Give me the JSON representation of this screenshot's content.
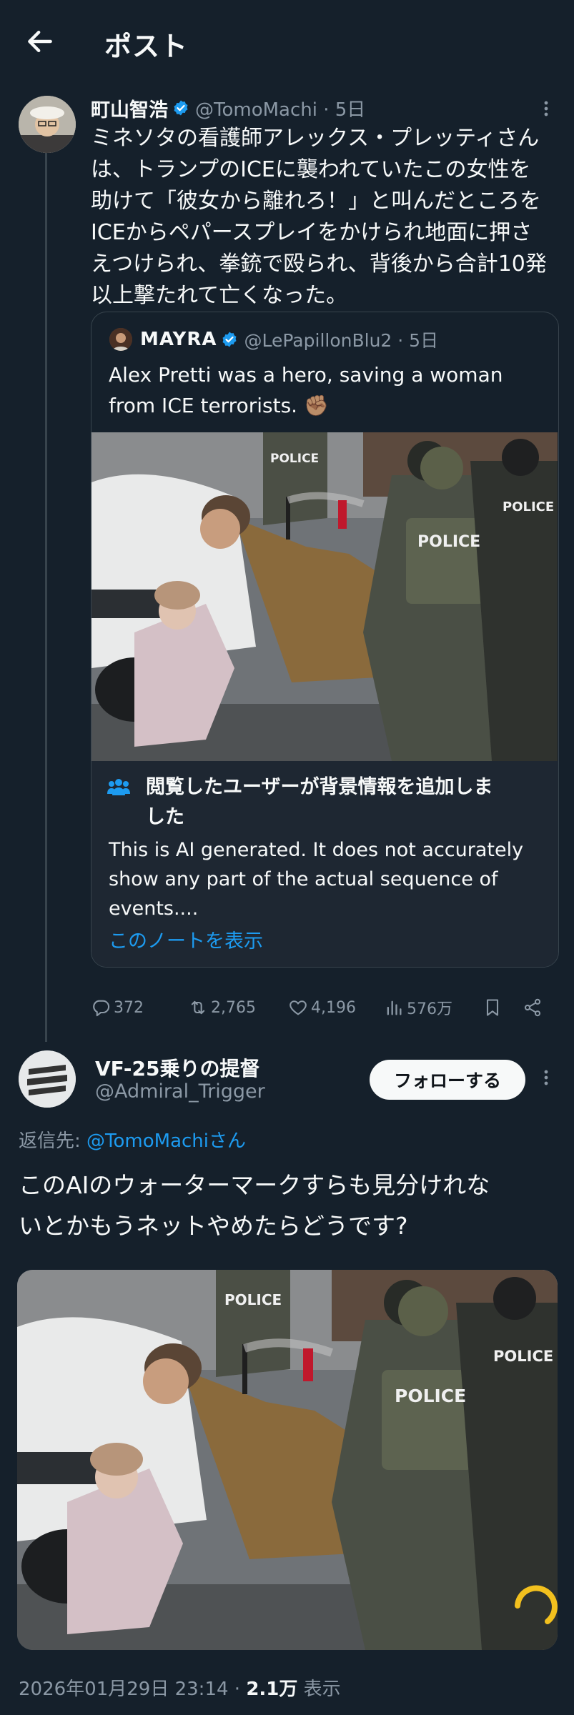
{
  "header": {
    "title": "ポスト"
  },
  "tweet": {
    "author_name": "町山智浩",
    "handle_time": "@TomoMachi · 5日",
    "body": "ミネソタの看護師アレックス・プレッティさん\nは、トランプのICEに襲われていたこの女性を\n助けて「彼女から離れろ！」と叫んだところを\nICEからペパースプレイをかけられ地面に押さ\nえつけられ、拳銃で殴られ、背後から合計10発\n以上撃たれて亡くなった。",
    "quote": {
      "author_name": "MAYRA",
      "handle_time": "@LePapillonBlu2 · 5日",
      "text": "Alex Pretti was a hero, saving a woman\nfrom ICE terrorists. ✊🏽",
      "photo_labels": [
        "POLICE",
        "POLICE",
        "POLICE"
      ]
    },
    "community_note": {
      "title": "閲覧したユーザーが背景情報を追加しま\nした",
      "text": "This is AI generated. It does not accurately\nshow any part of the actual sequence of\nevents....",
      "link": "このノートを表示"
    },
    "stats": {
      "replies": "372",
      "reposts": "2,765",
      "likes": "4,196",
      "views": "576万"
    }
  },
  "reply": {
    "author_name": "VF-25乗りの提督",
    "handle": "@Admiral_Trigger",
    "follow_label": "フォローする",
    "reply_prefix": "返信先: ",
    "reply_mention": "@TomoMachi",
    "reply_suffix": "さん",
    "body": "このAIのウォーターマークすらも見分けれな\nいとかもうネットやめたらどうです?",
    "photo_labels": [
      "POLICE",
      "POLICE",
      "POLICE"
    ],
    "timestamp": "2026年01月29日 23:14 · ",
    "views_count": "2.1万",
    "views_suffix": " 表示"
  },
  "colors": {
    "background": "#15202b",
    "text": "#f7f9f9",
    "secondary": "#8b98a5",
    "accent": "#1d9bf0",
    "border": "#38444d",
    "note_bg": "#1e2732"
  }
}
